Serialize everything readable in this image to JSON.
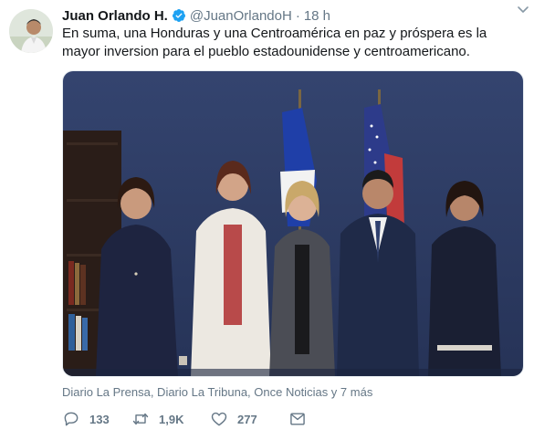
{
  "tweet": {
    "display_name": "Juan Orlando H.",
    "handle": "@JuanOrlandoH",
    "separator": "·",
    "time": "18 h",
    "text": "En suma, una Honduras y una Centroamérica en paz y próspera es la mayor inversion para el pueblo estadounidense y centroamericano.",
    "attribution": "Diario La Prensa, Diario La Tribuna, Once Noticias y 7 más"
  },
  "actions": {
    "replies": "133",
    "retweets": "1,9K",
    "likes": "277"
  },
  "icons": {
    "verified": "verified-badge-icon",
    "caret": "chevron-down-icon",
    "reply": "reply-icon",
    "retweet": "retweet-icon",
    "like": "heart-icon",
    "dm": "envelope-icon"
  },
  "colors": {
    "verified": "#1da1f2",
    "muted": "#657786",
    "text": "#14171a",
    "backdrop": "#2b3a63"
  }
}
